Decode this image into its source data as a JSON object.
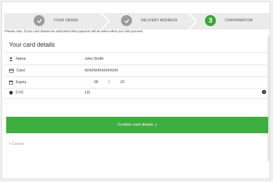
{
  "steps": [
    {
      "label": "YOUR ORDER",
      "state": "done",
      "icon": "check-icon"
    },
    {
      "label": "DELIVERY ADDRESS",
      "state": "done",
      "icon": "check-icon"
    },
    {
      "label": "CONFIRMATION",
      "state": "active",
      "number": "3"
    }
  ],
  "notice": "*Please note, if your card details are authorised then payment will be taken when you click proceed",
  "card": {
    "title": "Your card details",
    "name_label": "Name",
    "name_value": "John Smith",
    "card_label": "Card",
    "card_value": "4242424242424242",
    "expiry_label": "Expiry",
    "expiry_month": "05",
    "expiry_sep": "/",
    "expiry_year": "22",
    "cvc_label": "CVC",
    "cvc_value": "111",
    "help_icon": "?"
  },
  "confirm_label": "Confirm card details",
  "confirm_chevron": "›",
  "cancel_label": "Cancel",
  "cancel_chevron": "‹",
  "colors": {
    "accent": "#3fae40",
    "step_active": "#3aa63a",
    "step_done": "#9c9c9c"
  }
}
